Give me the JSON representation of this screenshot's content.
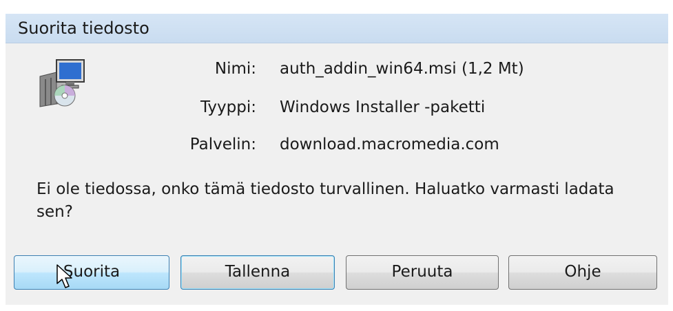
{
  "window": {
    "title": "Suorita tiedosto"
  },
  "file_info": {
    "name_label": "Nimi:",
    "name_value": "auth_addin_win64.msi (1,2 Mt)",
    "type_label": "Tyyppi:",
    "type_value": "Windows Installer -paketti",
    "server_label": "Palvelin:",
    "server_value": "download.macromedia.com",
    "icon": "installer-package-icon"
  },
  "warning": {
    "text": "Ei ole tiedossa, onko tämä tiedosto turvallinen. Haluatko varmasti ladata sen?"
  },
  "buttons": {
    "run_label": "Suorita",
    "save_label": "Tallenna",
    "cancel_label": "Peruuta",
    "help_label": "Ohje"
  },
  "colors": {
    "titlebar": "#d6e5f5",
    "body": "#f0f0f0",
    "focus_border": "#3c7fb1"
  }
}
